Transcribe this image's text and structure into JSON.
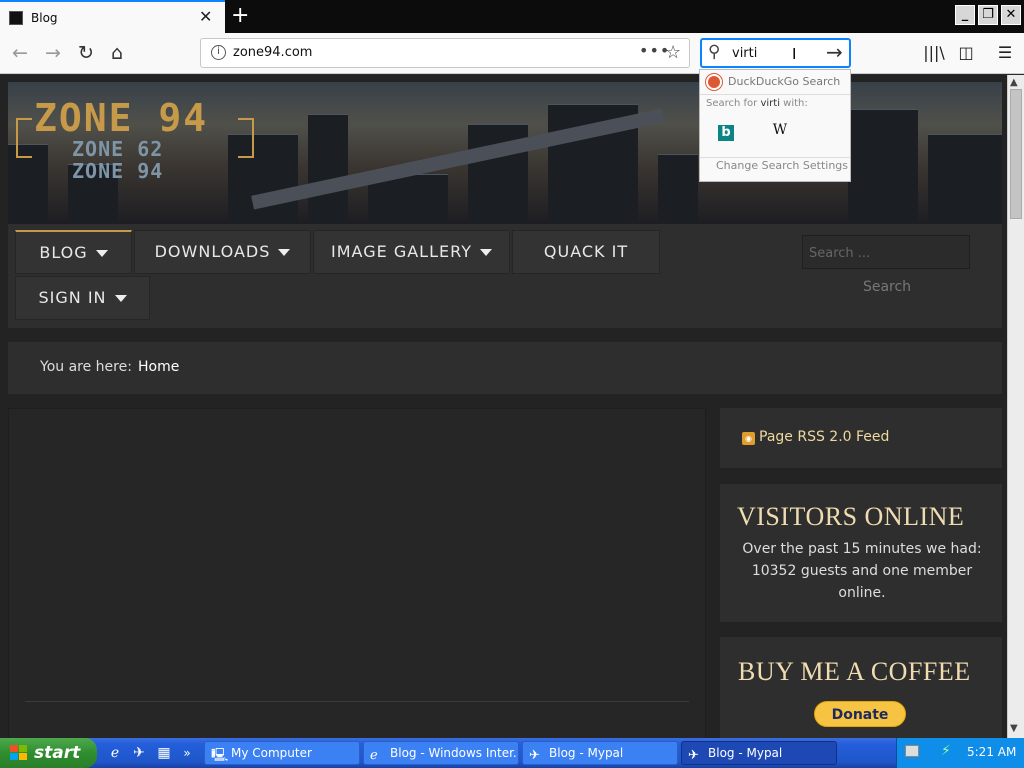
{
  "browser": {
    "tab_title": "Blog",
    "tab_close": "✕",
    "new_tab": "+",
    "url": "zone94.com",
    "url_dots": "•••",
    "search_query": "virti",
    "window_min": "_",
    "window_restore": "❐",
    "window_close": "✕"
  },
  "search_popup": {
    "engine_label": "DuckDuckGo Search",
    "search_for_prefix": "Search for ",
    "search_for_query": "virti",
    "search_for_suffix": " with:",
    "bing_glyph": "b",
    "wiki_glyph": "W",
    "change_settings": "Change Search Settings"
  },
  "site": {
    "logo_main": "ZONE 94",
    "logo_sub1": "ZONE 62",
    "logo_sub2": "ZONE 94",
    "menu": [
      {
        "label": "BLOG",
        "dropdown": true
      },
      {
        "label": "DOWNLOADS",
        "dropdown": true
      },
      {
        "label": "IMAGE GALLERY",
        "dropdown": true
      },
      {
        "label": "QUACK IT",
        "dropdown": false
      },
      {
        "label": "SIGN IN",
        "dropdown": true
      }
    ],
    "search_placeholder": "Search ...",
    "search_button": "Search",
    "breadcrumb_label": "You are here:",
    "breadcrumb_home": "Home",
    "rss_label": "Page RSS 2.0 Feed",
    "visitors_title": "VISITORS ONLINE",
    "visitors_text": "Over the past 15 minutes we had: 10352 guests and one member online.",
    "coffee_title": "BUY ME A COFFEE",
    "donate_label": "Donate"
  },
  "taskbar": {
    "start_label": "start",
    "tasks": [
      {
        "label": "My Computer"
      },
      {
        "label": "Blog - Windows Inter..."
      },
      {
        "label": "Blog - Mypal"
      },
      {
        "label": "Blog - Mypal"
      }
    ],
    "clock": "5:21 AM",
    "quicklaunch_more": "»"
  },
  "icons": [
    "back-icon",
    "forward-icon",
    "reload-icon",
    "home-icon",
    "info-icon",
    "star-icon",
    "search-icon",
    "arrow-right-icon",
    "library-icon",
    "sidebar-icon",
    "menu-icon",
    "duckduckgo-icon",
    "bing-icon",
    "wikipedia-icon",
    "rss-icon",
    "windows-flag-icon"
  ],
  "colors": {
    "accent": "#0a84ff",
    "site_gold": "#c79a4a",
    "heading_cream": "#f0dcb0",
    "donate_yellow": "#f7c343",
    "taskbar_blue": "#245edb",
    "start_green": "#2f8e2f"
  }
}
